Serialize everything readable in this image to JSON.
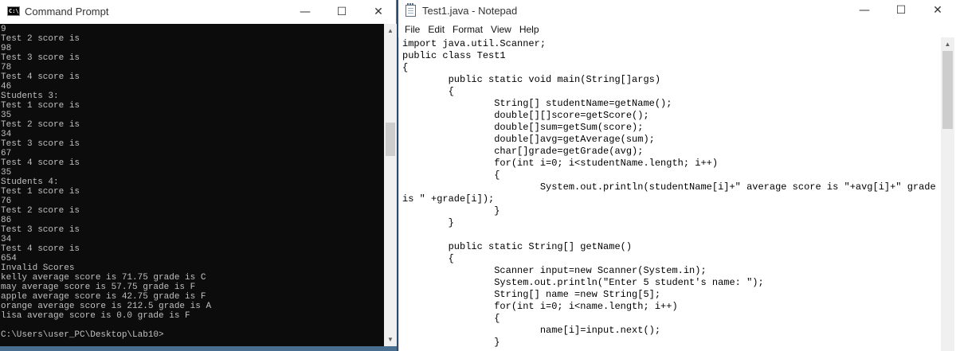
{
  "cmd": {
    "title": "Command Prompt",
    "icon_text": "C:\\.",
    "controls": {
      "minimize": "—",
      "maximize": "☐",
      "close": "✕"
    },
    "scroll_up": "▲",
    "scroll_down": "▼",
    "lines": [
      "9",
      "Test 2 score is",
      "98",
      "Test 3 score is",
      "78",
      "Test 4 score is",
      "46",
      "Students 3:",
      "Test 1 score is",
      "35",
      "Test 2 score is",
      "34",
      "Test 3 score is",
      "67",
      "Test 4 score is",
      "35",
      "Students 4:",
      "Test 1 score is",
      "76",
      "Test 2 score is",
      "86",
      "Test 3 score is",
      "34",
      "Test 4 score is",
      "654",
      "Invalid Scores",
      "kelly average score is 71.75 grade is C",
      "may average score is 57.75 grade is F",
      "apple average score is 42.75 grade is F",
      "orange average score is 212.5 grade is A",
      "lisa average score is 0.0 grade is F",
      "",
      "C:\\Users\\user_PC\\Desktop\\Lab10>"
    ]
  },
  "notepad": {
    "title": "Test1.java - Notepad",
    "controls": {
      "minimize": "—",
      "maximize": "☐",
      "close": "✕"
    },
    "menu": [
      "File",
      "Edit",
      "Format",
      "View",
      "Help"
    ],
    "scroll_up": "▲",
    "scroll_down": "▼",
    "code_lines": [
      "import java.util.Scanner;",
      "public class Test1",
      "{",
      "        public static void main(String[]args)",
      "        {",
      "                String[] studentName=getName();",
      "                double[][]score=getScore();",
      "                double[]sum=getSum(score);",
      "                double[]avg=getAverage(sum);",
      "                char[]grade=getGrade(avg);",
      "                for(int i=0; i<studentName.length; i++)",
      "                {",
      "                        System.out.println(studentName[i]+\" average score is \"+avg[i]+\" grade",
      "is \" +grade[i]);",
      "                }",
      "        }",
      "",
      "        public static String[] getName()",
      "        {",
      "                Scanner input=new Scanner(System.in);",
      "                System.out.println(\"Enter 5 student's name: \");",
      "                String[] name =new String[5];",
      "                for(int i=0; i<name.length; i++)",
      "                {",
      "                        name[i]=input.next();",
      "                }"
    ]
  }
}
